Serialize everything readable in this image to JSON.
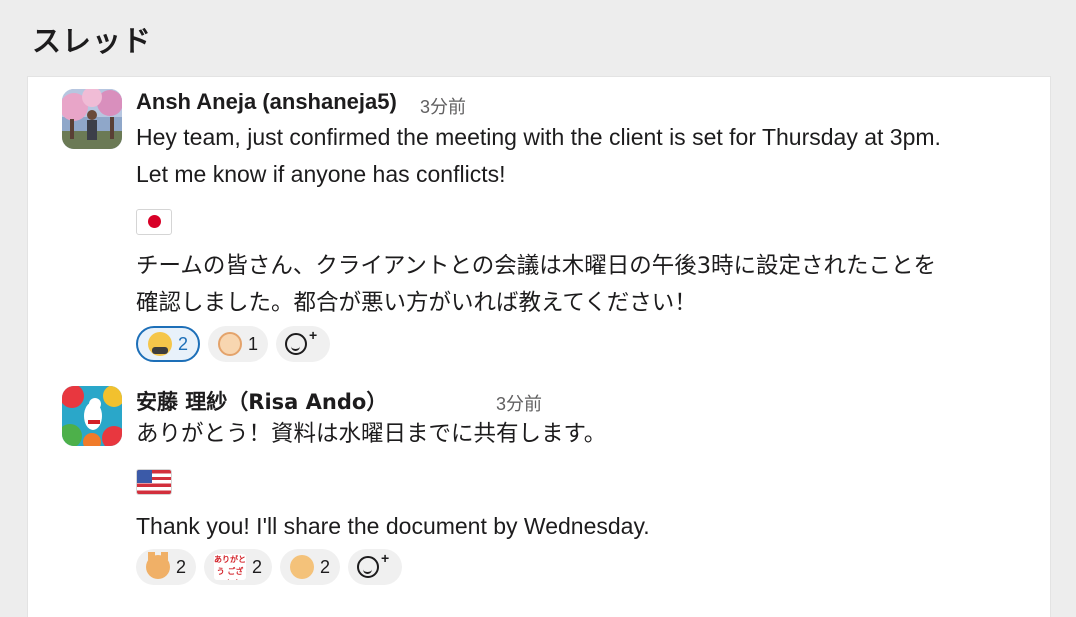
{
  "thread": {
    "title": "スレッド"
  },
  "messages": [
    {
      "author": "Ansh Aneja (anshaneja5)",
      "timestamp": "3分前",
      "text_en": "Hey team, just confirmed the meeting with the client is set for Thursday at 3pm.\nLet me know if anyone has conflicts!",
      "flag_icon": "flag-japan-icon",
      "text_jp": "チームの皆さん、クライアントとの会議は木曜日の午後3時に設定されたことを\n確認しました。都合が悪い方がいれば教えてください！",
      "reactions": [
        {
          "icon": "bowing-person-icon",
          "count": "2",
          "active": true
        },
        {
          "icon": "monkey-face-icon",
          "count": "1",
          "active": false
        }
      ]
    },
    {
      "author": "安藤 理紗（Risa Ando）",
      "timestamp": "3分前",
      "text_jp": "ありがとう！資料は水曜日までに共有します。",
      "flag_icon": "flag-usa-icon",
      "text_en": "Thank you! I'll share the document by Wednesday.",
      "reactions": [
        {
          "icon": "cat-icon",
          "count": "2",
          "active": false
        },
        {
          "icon": "arigatou-sticker-icon",
          "sticker_text": "ありがとう\nございます!",
          "count": "2",
          "active": false
        },
        {
          "icon": "tiger-icon",
          "count": "2",
          "active": false
        }
      ]
    }
  ],
  "colors": {
    "active_reaction": "#1d6fb8",
    "panel_bg": "#ffffff",
    "page_bg": "#ededed"
  }
}
